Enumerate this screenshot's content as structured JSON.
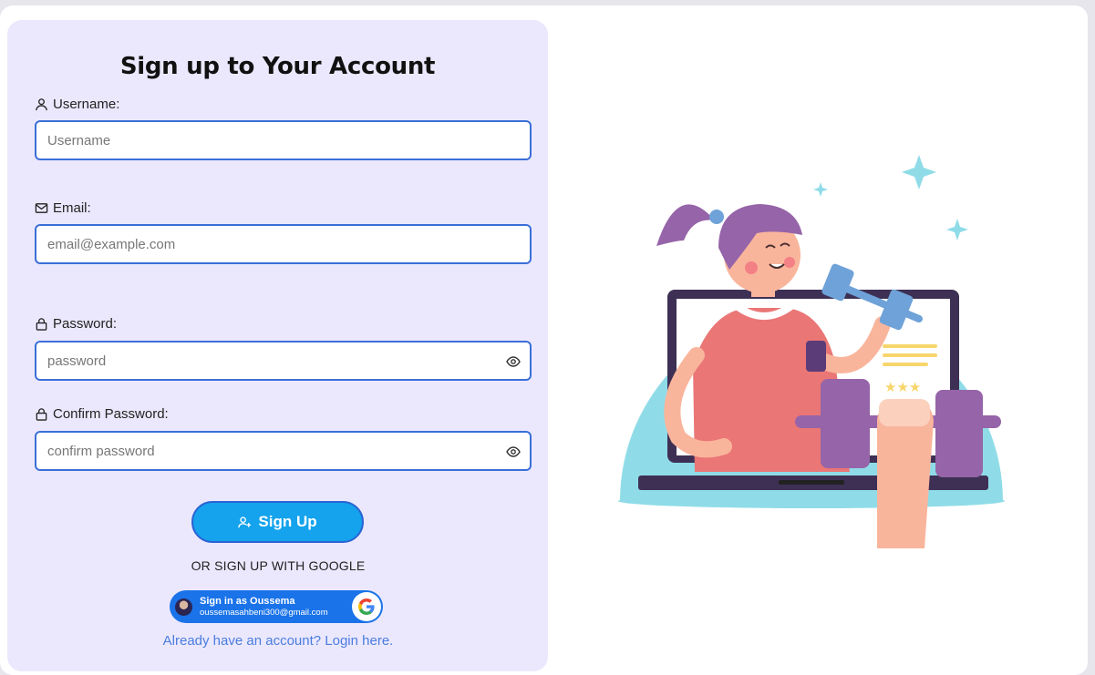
{
  "form": {
    "title": "Sign up to Your Account",
    "username": {
      "label": "Username:",
      "placeholder": "Username",
      "value": ""
    },
    "email": {
      "label": "Email:",
      "placeholder": "email@example.com",
      "value": ""
    },
    "password": {
      "label": "Password:",
      "placeholder": "password",
      "value": ""
    },
    "confirm_password": {
      "label": "Confirm Password:",
      "placeholder": "confirm password",
      "value": ""
    },
    "submit_label": "Sign Up",
    "divider_text": "OR SIGN UP WITH GOOGLE",
    "google": {
      "name_text": "Sign in as Oussema",
      "email_text": "oussemasahbeni300@gmail.com"
    },
    "login_link": "Already have an account? Login here."
  },
  "icons": {
    "username": "user-icon",
    "email": "mail-icon",
    "password": "lock-icon",
    "confirm_password": "lock-icon",
    "toggle": "eye-icon",
    "submit": "user-plus-icon",
    "google": "google-logo-icon"
  },
  "colors": {
    "panel_bg": "#ebe8fd",
    "field_border": "#3a6fd8",
    "button_bg": "#14a3ec",
    "google_bg": "#1a73e8",
    "link": "#4a7de0"
  }
}
